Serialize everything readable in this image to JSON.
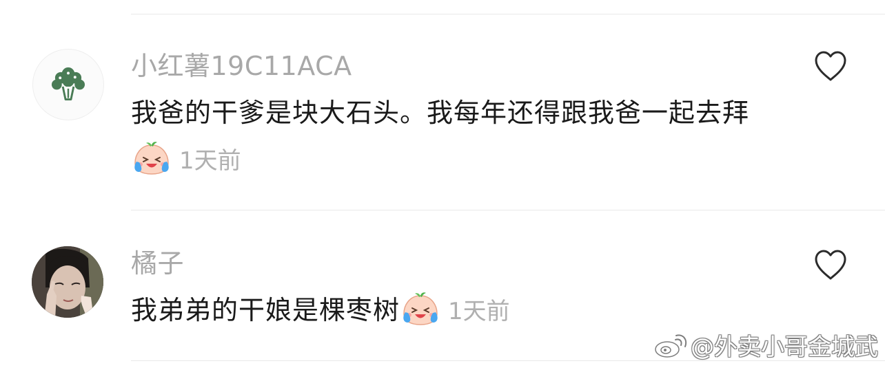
{
  "comments": [
    {
      "username": "小红薯19C11ACA",
      "text": "我爸的干爹是块大石头。我每年还得跟我爸一起去拜",
      "emoji": "crying-laughing-face",
      "time": "1天前",
      "avatar": "broccoli-icon"
    },
    {
      "username": "橘子",
      "text": "我弟弟的干娘是棵枣树",
      "emoji": "crying-laughing-face",
      "time": "1天前",
      "avatar": "user-photo"
    }
  ],
  "watermark": {
    "text": "@外卖小哥金城武",
    "icon": "weibo-icon"
  },
  "colors": {
    "username": "#a8a8a8",
    "body": "#1a1a1a",
    "time": "#b0b0b0",
    "divider": "#e9e9e9",
    "broccoli": "#4a7c56"
  }
}
